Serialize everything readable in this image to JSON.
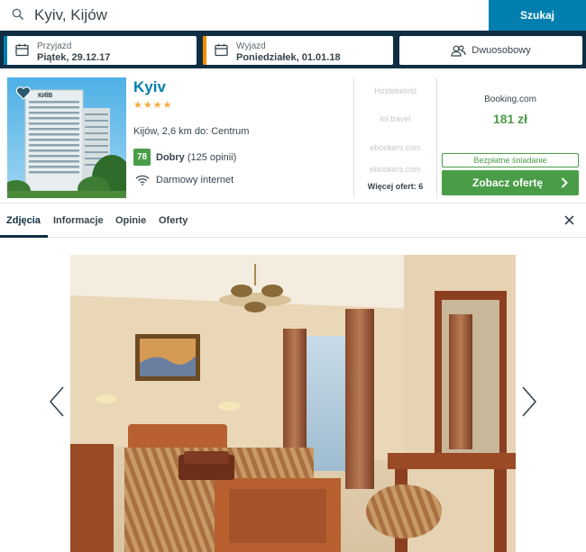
{
  "search": {
    "value": "Kyiv, Kijów",
    "button_label": "Szukaj"
  },
  "checkin": {
    "label": "Przyjazd",
    "value": "Piątek, 29.12.17",
    "accent": "#007faf"
  },
  "checkout": {
    "label": "Wyjazd",
    "value": "Poniedziałek, 01.01.18",
    "accent": "#f48f00"
  },
  "room": {
    "label": "Dwuosobowy"
  },
  "hotel": {
    "name": "Kyiv",
    "stars": "★★★★",
    "distance": "Kijów, 2,6 km do: Centrum",
    "rating_score": "78",
    "rating_label": "Dobry",
    "rating_reviews": "(125 opinii)",
    "amenity": "Darmowy internet",
    "sign_text": "КИЇВ"
  },
  "offers": {
    "sites": [
      "Hostelworld",
      "lol.travel",
      "ebookers.com",
      "ebookers.com"
    ],
    "more_label": "Więcej ofert: 6"
  },
  "best_deal": {
    "site": "Booking.com",
    "price": "181 zł",
    "breakfast": "Bezpłatne śniadanie",
    "button_label": "Zobacz ofertę"
  },
  "tabs": [
    "Zdjęcia",
    "Informacje",
    "Opinie",
    "Oferty"
  ],
  "colors": {
    "navy": "#0f2e44",
    "blue": "#007faf",
    "green": "#4a9d48",
    "star": "#f6ab3f"
  }
}
